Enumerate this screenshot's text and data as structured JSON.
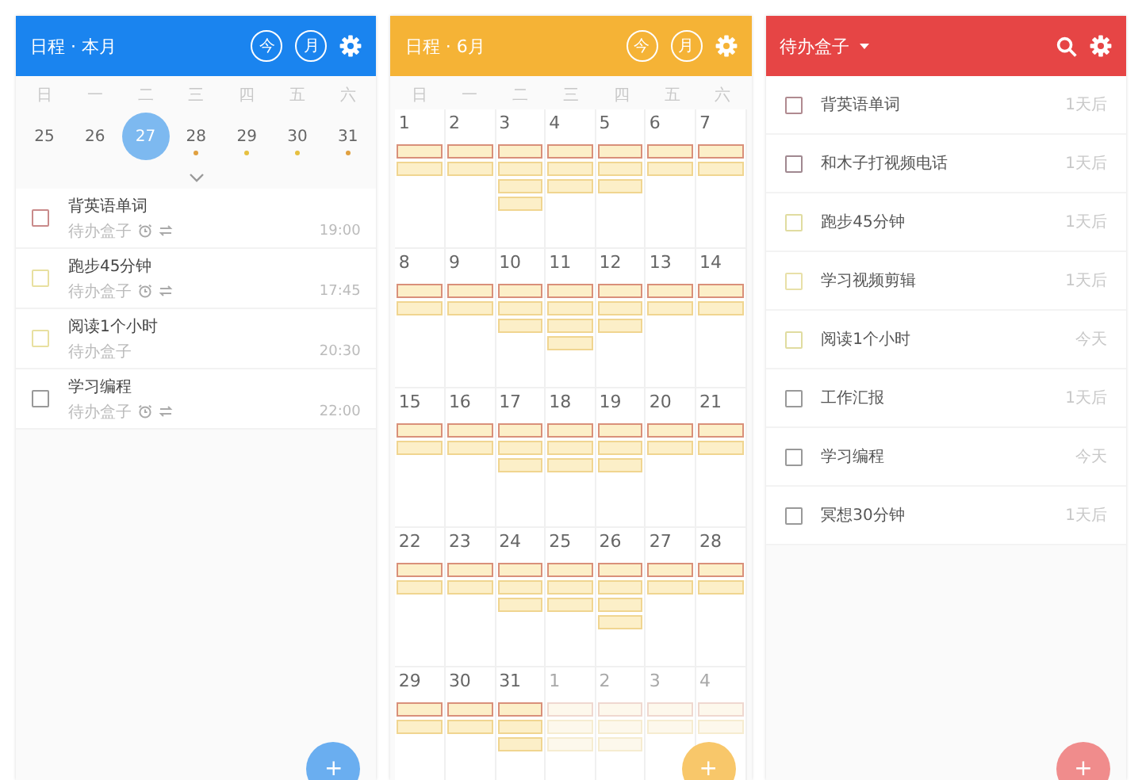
{
  "day_view": {
    "header": {
      "title": "日程 · 本月",
      "buttons": [
        "今",
        "月"
      ]
    },
    "weekdays": [
      "日",
      "一",
      "二",
      "三",
      "四",
      "五",
      "六"
    ],
    "dates": [
      {
        "day": "25",
        "selected": false
      },
      {
        "day": "26",
        "selected": false
      },
      {
        "day": "27",
        "selected": true
      },
      {
        "day": "28",
        "selected": false,
        "color": "#e0a040"
      },
      {
        "day": "29",
        "selected": false,
        "color": "#e6c040"
      },
      {
        "day": "30",
        "selected": false,
        "color": "#e6c040"
      },
      {
        "day": "31",
        "selected": false,
        "color": "#e0a040"
      }
    ],
    "tasks": [
      {
        "title": "背英语单词",
        "list": "待办盒子",
        "time": "19:00",
        "color": "#c98a8a",
        "alarm": true,
        "repeat": true
      },
      {
        "title": "跑步45分钟",
        "list": "待办盒子",
        "time": "17:45",
        "color": "#e8e0a0",
        "alarm": true,
        "repeat": true
      },
      {
        "title": "阅读1个小时",
        "list": "待办盒子",
        "time": "20:30",
        "color": "#e8e0a0",
        "alarm": false,
        "repeat": false
      },
      {
        "title": "学习编程",
        "list": "待办盒子",
        "time": "22:00",
        "color": "#999999",
        "alarm": true,
        "repeat": true
      }
    ],
    "add_button": "+"
  },
  "month_view": {
    "header": {
      "title": "日程 · 6月",
      "buttons": [
        "今",
        "月"
      ]
    },
    "weekdays": [
      "日",
      "一",
      "二",
      "三",
      "四",
      "五",
      "六"
    ],
    "weeks": [
      [
        {
          "day": "1",
          "outside": false,
          "events": [
            {
              "color": "#d9907a"
            },
            {
              "color": "#f0d590"
            }
          ]
        },
        {
          "day": "2",
          "outside": false,
          "events": [
            {
              "color": "#d9907a"
            },
            {
              "color": "#f0d590"
            }
          ]
        },
        {
          "day": "3",
          "outside": false,
          "events": [
            {
              "color": "#d9907a"
            },
            {
              "color": "#f0d590"
            },
            {
              "color": "#f0d590"
            },
            {
              "color": "#f0d590"
            }
          ]
        },
        {
          "day": "4",
          "outside": false,
          "events": [
            {
              "color": "#d9907a"
            },
            {
              "color": "#f0d590"
            },
            {
              "color": "#f0d590"
            }
          ]
        },
        {
          "day": "5",
          "outside": false,
          "events": [
            {
              "color": "#d9907a"
            },
            {
              "color": "#f0d590"
            },
            {
              "color": "#f0d590"
            }
          ]
        },
        {
          "day": "6",
          "outside": false,
          "events": [
            {
              "color": "#d9907a"
            },
            {
              "color": "#f0d590"
            }
          ]
        },
        {
          "day": "7",
          "outside": false,
          "events": [
            {
              "color": "#d9907a"
            },
            {
              "color": "#f0d590"
            }
          ]
        }
      ],
      [
        {
          "day": "8",
          "outside": false,
          "events": [
            {
              "color": "#d9907a"
            },
            {
              "color": "#f0d590"
            }
          ]
        },
        {
          "day": "9",
          "outside": false,
          "events": [
            {
              "color": "#d9907a"
            },
            {
              "color": "#f0d590"
            }
          ]
        },
        {
          "day": "10",
          "outside": false,
          "events": [
            {
              "color": "#d9907a"
            },
            {
              "color": "#f0d590"
            },
            {
              "color": "#f0d590"
            }
          ]
        },
        {
          "day": "11",
          "outside": false,
          "events": [
            {
              "color": "#d9907a"
            },
            {
              "color": "#f0d590"
            },
            {
              "color": "#f0d590"
            },
            {
              "color": "#f0d590"
            }
          ]
        },
        {
          "day": "12",
          "outside": false,
          "events": [
            {
              "color": "#d9907a"
            },
            {
              "color": "#f0d590"
            },
            {
              "color": "#f0d590"
            }
          ]
        },
        {
          "day": "13",
          "outside": false,
          "events": [
            {
              "color": "#d9907a"
            },
            {
              "color": "#f0d590"
            }
          ]
        },
        {
          "day": "14",
          "outside": false,
          "events": [
            {
              "color": "#d9907a"
            },
            {
              "color": "#f0d590"
            }
          ]
        }
      ],
      [
        {
          "day": "15",
          "outside": false,
          "events": [
            {
              "color": "#d9907a"
            },
            {
              "color": "#f0d590"
            }
          ]
        },
        {
          "day": "16",
          "outside": false,
          "events": [
            {
              "color": "#d9907a"
            },
            {
              "color": "#f0d590"
            }
          ]
        },
        {
          "day": "17",
          "outside": false,
          "events": [
            {
              "color": "#d9907a"
            },
            {
              "color": "#f0d590"
            },
            {
              "color": "#f0d590"
            }
          ]
        },
        {
          "day": "18",
          "outside": false,
          "events": [
            {
              "color": "#d9907a"
            },
            {
              "color": "#f0d590"
            },
            {
              "color": "#f0d590"
            }
          ]
        },
        {
          "day": "19",
          "outside": false,
          "events": [
            {
              "color": "#d9907a"
            },
            {
              "color": "#f0d590"
            },
            {
              "color": "#f0d590"
            }
          ]
        },
        {
          "day": "20",
          "outside": false,
          "events": [
            {
              "color": "#d9907a"
            },
            {
              "color": "#f0d590"
            }
          ]
        },
        {
          "day": "21",
          "outside": false,
          "events": [
            {
              "color": "#d9907a"
            },
            {
              "color": "#f0d590"
            }
          ]
        }
      ],
      [
        {
          "day": "22",
          "outside": false,
          "events": [
            {
              "color": "#d9907a"
            },
            {
              "color": "#f0d590"
            }
          ]
        },
        {
          "day": "23",
          "outside": false,
          "events": [
            {
              "color": "#d9907a"
            },
            {
              "color": "#f0d590"
            }
          ]
        },
        {
          "day": "24",
          "outside": false,
          "events": [
            {
              "color": "#d9907a"
            },
            {
              "color": "#f0d590"
            },
            {
              "color": "#f0d590"
            }
          ]
        },
        {
          "day": "25",
          "outside": false,
          "events": [
            {
              "color": "#d9907a"
            },
            {
              "color": "#f0d590"
            },
            {
              "color": "#f0d590"
            }
          ]
        },
        {
          "day": "26",
          "outside": false,
          "events": [
            {
              "color": "#d9907a"
            },
            {
              "color": "#f0d590"
            },
            {
              "color": "#f0d590"
            },
            {
              "color": "#f0d590"
            }
          ]
        },
        {
          "day": "27",
          "outside": false,
          "events": [
            {
              "color": "#d9907a"
            },
            {
              "color": "#f0d590"
            }
          ]
        },
        {
          "day": "28",
          "outside": false,
          "events": [
            {
              "color": "#d9907a"
            },
            {
              "color": "#f0d590"
            }
          ]
        }
      ],
      [
        {
          "day": "29",
          "outside": false,
          "events": [
            {
              "color": "#d9907a"
            },
            {
              "color": "#f0d590"
            }
          ]
        },
        {
          "day": "30",
          "outside": false,
          "events": [
            {
              "color": "#d9907a"
            },
            {
              "color": "#f0d590"
            }
          ]
        },
        {
          "day": "31",
          "outside": false,
          "events": [
            {
              "color": "#d9907a"
            },
            {
              "color": "#f0d590"
            },
            {
              "color": "#f0d590"
            }
          ]
        },
        {
          "day": "1",
          "outside": true,
          "events": [
            {
              "color": "#efd8d0"
            },
            {
              "color": "#f6ecd0"
            },
            {
              "color": "#f6ecd0"
            }
          ]
        },
        {
          "day": "2",
          "outside": true,
          "events": [
            {
              "color": "#efd8d0"
            },
            {
              "color": "#f6ecd0"
            },
            {
              "color": "#f6ecd0"
            }
          ]
        },
        {
          "day": "3",
          "outside": true,
          "events": [
            {
              "color": "#efd8d0"
            },
            {
              "color": "#f6ecd0"
            }
          ]
        },
        {
          "day": "4",
          "outside": true,
          "events": [
            {
              "color": "#efd8d0"
            },
            {
              "color": "#f6ecd0"
            }
          ]
        }
      ]
    ],
    "add_button": "+"
  },
  "todo_view": {
    "header": {
      "title": "待办盒子"
    },
    "items": [
      {
        "title": "背英语单词",
        "due": "1天后",
        "color": "#b08a90"
      },
      {
        "title": "和木子打视频电话",
        "due": "1天后",
        "color": "#a08890"
      },
      {
        "title": "跑步45分钟",
        "due": "1天后",
        "color": "#e0dca0"
      },
      {
        "title": "学习视频剪辑",
        "due": "1天后",
        "color": "#e8e0a8"
      },
      {
        "title": "阅读1个小时",
        "due": "今天",
        "color": "#e0dca0"
      },
      {
        "title": "工作汇报",
        "due": "1天后",
        "color": "#999999"
      },
      {
        "title": "学习编程",
        "due": "今天",
        "color": "#999999"
      },
      {
        "title": "冥想30分钟",
        "due": "1天后",
        "color": "#999999"
      }
    ],
    "add_button": "+"
  }
}
